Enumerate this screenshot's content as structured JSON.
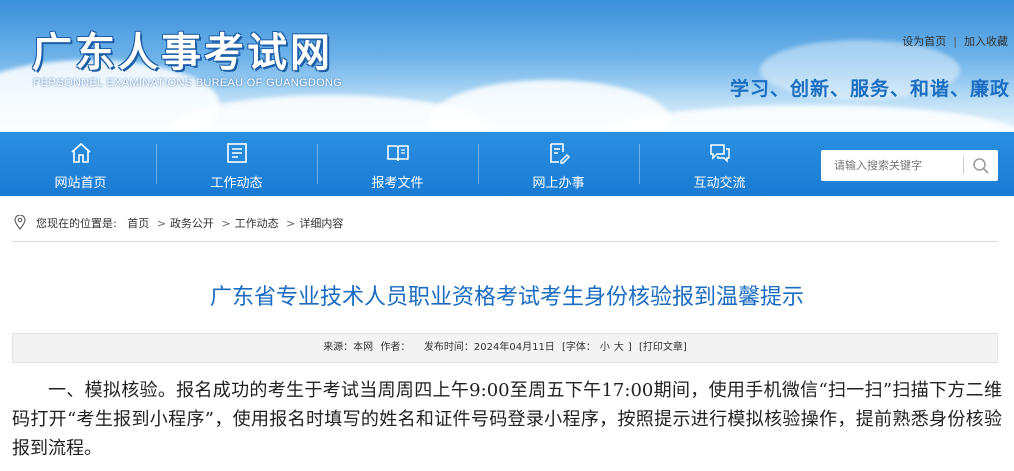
{
  "header": {
    "logo_cn": "广东人事考试网",
    "logo_en": "PERSONNEL EXAMINATIONS BUREAU OF GUANGDONG",
    "set_home": "设为首页",
    "separator": "|",
    "add_favorite": "加入收藏",
    "slogan": "学习、创新、服务、和谐、廉政"
  },
  "nav": {
    "items": [
      {
        "label": "网站首页",
        "icon": "home-icon"
      },
      {
        "label": "工作动态",
        "icon": "news-icon"
      },
      {
        "label": "报考文件",
        "icon": "book-icon"
      },
      {
        "label": "网上办事",
        "icon": "edit-document-icon"
      },
      {
        "label": "互动交流",
        "icon": "chat-icon"
      }
    ]
  },
  "search": {
    "placeholder": "请输入搜索关键字",
    "icon": "search-icon"
  },
  "breadcrumb": {
    "prefix": "您现在的位置是:",
    "items": [
      "首页",
      "政务公开",
      "工作动态",
      "详细内容"
    ],
    "arrow": ">"
  },
  "article": {
    "title": "广东省专业技术人员职业资格考试考生身份核验报到温馨提示",
    "source": "来源：本网",
    "author": "作者：",
    "published": "发布时间：2024年04月11日",
    "font_size_label": "[字体：",
    "font_small": "小",
    "font_large": "大",
    "font_size_close": "]",
    "print": "[打印文章]",
    "paragraph": "一、模拟核验。报名成功的考生于考试当周周四上午9:00至周五下午17:00期间，使用手机微信“扫一扫”扫描下方二维码打开“考生报到小程序”，使用报名时填写的姓名和证件号码登录小程序，按照提示进行模拟核验操作，提前熟悉身份核验报到流程。"
  },
  "colors": {
    "nav_bg": "#1b7bd4",
    "title": "#1a6cc2",
    "slogan": "#1b6ec2"
  }
}
